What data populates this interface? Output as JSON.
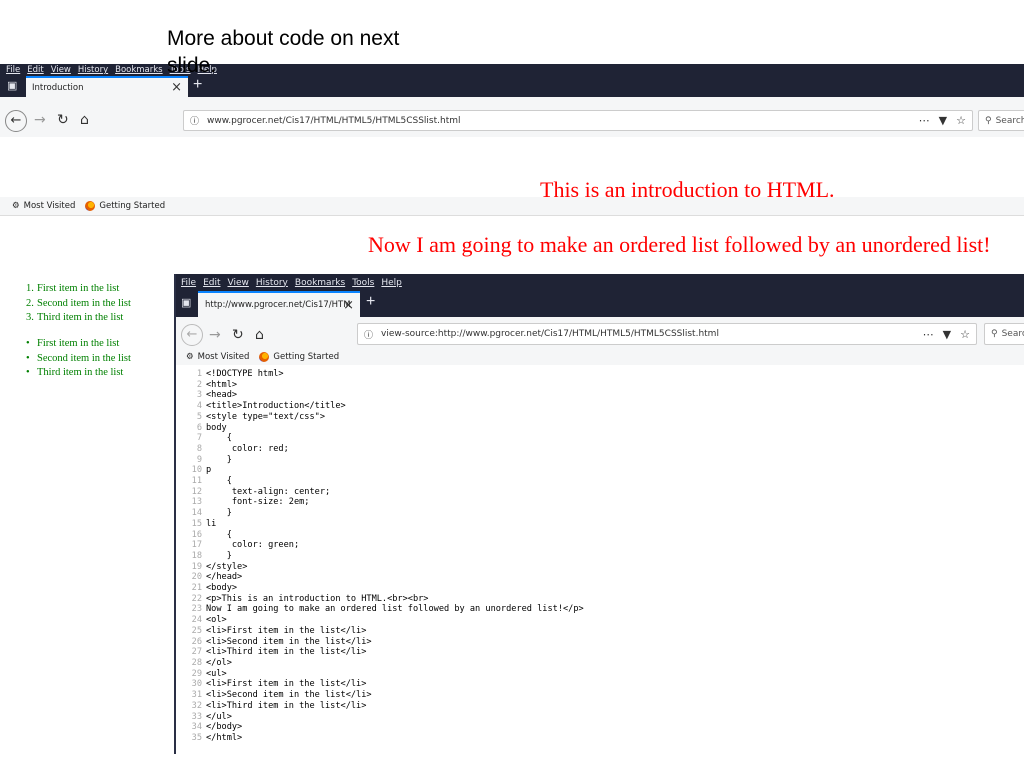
{
  "caption": "More about code on next slide.",
  "browser1": {
    "menu": [
      "File",
      "Edit",
      "View",
      "History",
      "Bookmarks",
      "Tools",
      "Help"
    ],
    "tab_title": "Introduction",
    "tab_close": "×",
    "new_tab": "+",
    "url": "www.pgrocer.net/Cis17/HTML/HTML5/HTML5CSSlist.html",
    "search_placeholder": "Search",
    "bookmarks": [
      {
        "icon": "gear-icon",
        "label": "Most Visited"
      },
      {
        "icon": "firefox-icon",
        "label": "Getting Started"
      }
    ],
    "page": {
      "heading": "This is an introduction to HTML.",
      "subheading": "Now I am going to make an ordered list followed by an unordered list!",
      "ordered_list": [
        "First item in the list",
        "Second item in the list",
        "Third item in the list"
      ],
      "unordered_list": [
        "First item in the list",
        "Second item in the list",
        "Third item in the list"
      ],
      "text_color": "#ff0000",
      "list_color": "#008000"
    }
  },
  "browser2": {
    "menu": [
      "File",
      "Edit",
      "View",
      "History",
      "Bookmarks",
      "Tools",
      "Help"
    ],
    "tab_title": "http://www.pgrocer.net/Cis17/HTM",
    "tab_close": "×",
    "new_tab": "+",
    "url": "view-source:http://www.pgrocer.net/Cis17/HTML/HTML5/HTML5CSSlist.html",
    "search_placeholder": "Search",
    "bookmarks": [
      {
        "icon": "gear-icon",
        "label": "Most Visited"
      },
      {
        "icon": "firefox-icon",
        "label": "Getting Started"
      }
    ],
    "source_lines": [
      "<!DOCTYPE html>",
      "<html>",
      "<head>",
      "<title>Introduction</title>",
      "<style type=\"text/css\">",
      "body",
      "    {",
      "     color: red;",
      "    }",
      "p",
      "    {",
      "     text-align: center;",
      "     font-size: 2em;",
      "    }",
      "li",
      "    {",
      "     color: green;",
      "    }",
      "</style>",
      "</head>",
      "<body>",
      "<p>This is an introduction to HTML.<br><br>",
      "Now I am going to make an ordered list followed by an unordered list!</p>",
      "<ol>",
      "<li>First item in the list</li>",
      "<li>Second item in the list</li>",
      "<li>Third item in the list</li>",
      "</ol>",
      "<ul>",
      "<li>First item in the list</li>",
      "<li>Second item in the list</li>",
      "<li>Third item in the list</li>",
      "</ul>",
      "</body>",
      "</html>"
    ]
  }
}
